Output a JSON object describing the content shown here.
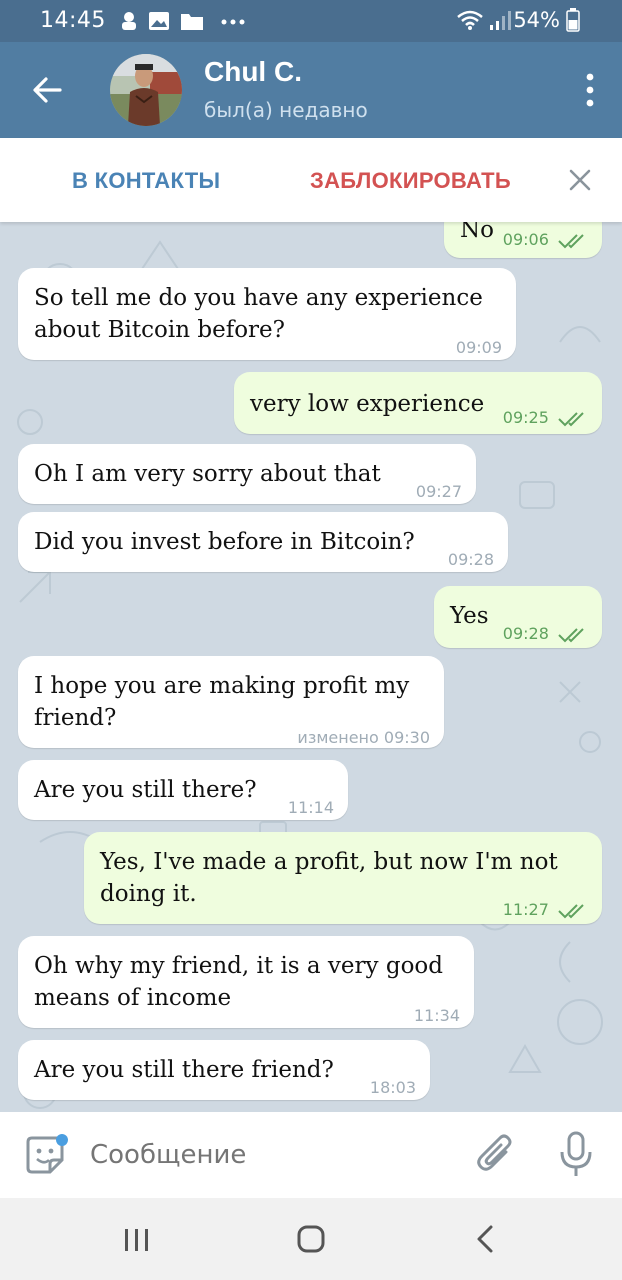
{
  "status_bar": {
    "time": "14:45",
    "battery": "54%"
  },
  "header": {
    "title": "Chul C.",
    "subtitle": "был(а) недавно"
  },
  "actions": {
    "add_contact": "В КОНТАКТЫ",
    "block": "ЗАБЛОКИРОВАТЬ"
  },
  "messages": [
    {
      "dir": "out",
      "text": "No",
      "time": "09:06"
    },
    {
      "dir": "in",
      "text": "So tell me do you have any experience\nabout Bitcoin before?",
      "time": "09:09"
    },
    {
      "dir": "out",
      "text": "very low experience",
      "time": "09:25"
    },
    {
      "dir": "in",
      "text": "Oh I am very sorry about that",
      "time": "09:27"
    },
    {
      "dir": "in",
      "text": "Did you invest before in Bitcoin?",
      "time": "09:28"
    },
    {
      "dir": "out",
      "text": "Yes",
      "time": "09:28"
    },
    {
      "dir": "in",
      "text": "I hope you are making profit my\nfriend?",
      "time": "изменено 09:30"
    },
    {
      "dir": "in",
      "text": "Are you still there?",
      "time": "11:14"
    },
    {
      "dir": "out",
      "text": "Yes, I've made a profit, but now I'm not\ndoing it.",
      "time": "11:27"
    },
    {
      "dir": "in",
      "text": "Oh why my friend, it is a very good\nmeans of income",
      "time": "11:34"
    },
    {
      "dir": "in",
      "text": "Are you still there friend?",
      "time": "18:03"
    }
  ],
  "input": {
    "placeholder": "Сообщение"
  },
  "icons": {
    "back": "arrow-left-icon",
    "more": "more-vertical-icon",
    "close": "close-icon",
    "emoji": "sticker-icon",
    "attach": "paperclip-icon",
    "mic": "microphone-icon",
    "read": "double-check-icon"
  },
  "colors": {
    "header": "#517da2",
    "status_bar": "#4a6e8f",
    "chat_bg": "#cfd9e2",
    "incoming_bubble": "#ffffff",
    "outgoing_bubble": "#effdde",
    "outgoing_time": "#5fa25e",
    "add_contact": "#4a83b5",
    "block": "#d35252"
  }
}
